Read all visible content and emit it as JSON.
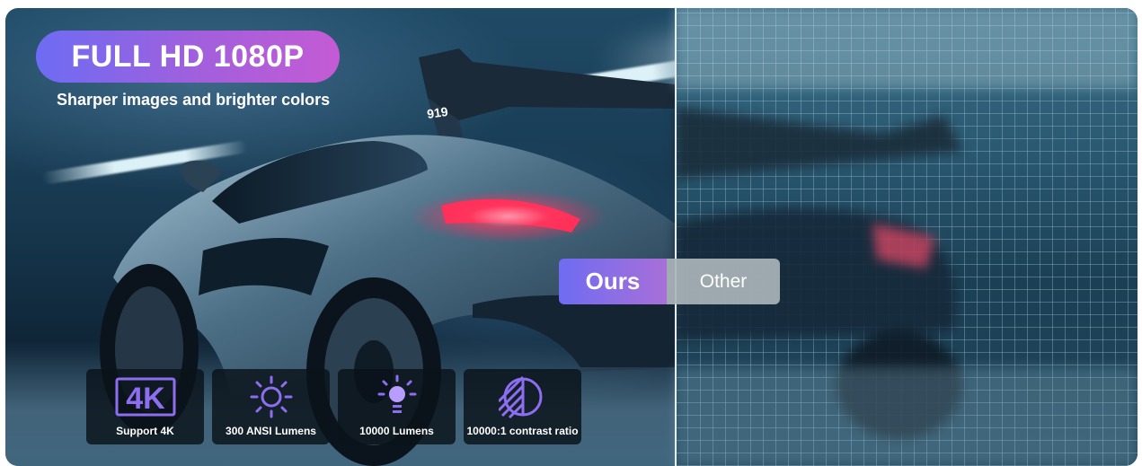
{
  "banner": {
    "title": "FULL HD 1080P",
    "subtitle": "Sharper images and brighter colors"
  },
  "compare_toggle": {
    "ours_label": "Ours",
    "other_label": "Other"
  },
  "features": [
    {
      "icon_text": "4K",
      "icon": "4k-icon",
      "label": "Support 4K"
    },
    {
      "icon": "sun-icon",
      "label": "300 ANSI Lumens"
    },
    {
      "icon": "lightbulb-icon",
      "label": "10000 Lumens"
    },
    {
      "icon": "contrast-icon",
      "label": "10000:1 contrast ratio"
    }
  ],
  "car_badge": "919",
  "colors": {
    "accent_start": "#6d6cf3",
    "accent_end": "#c45bd4",
    "icon_purple": "#8e6ef0",
    "taillight": "#ff2f57"
  }
}
